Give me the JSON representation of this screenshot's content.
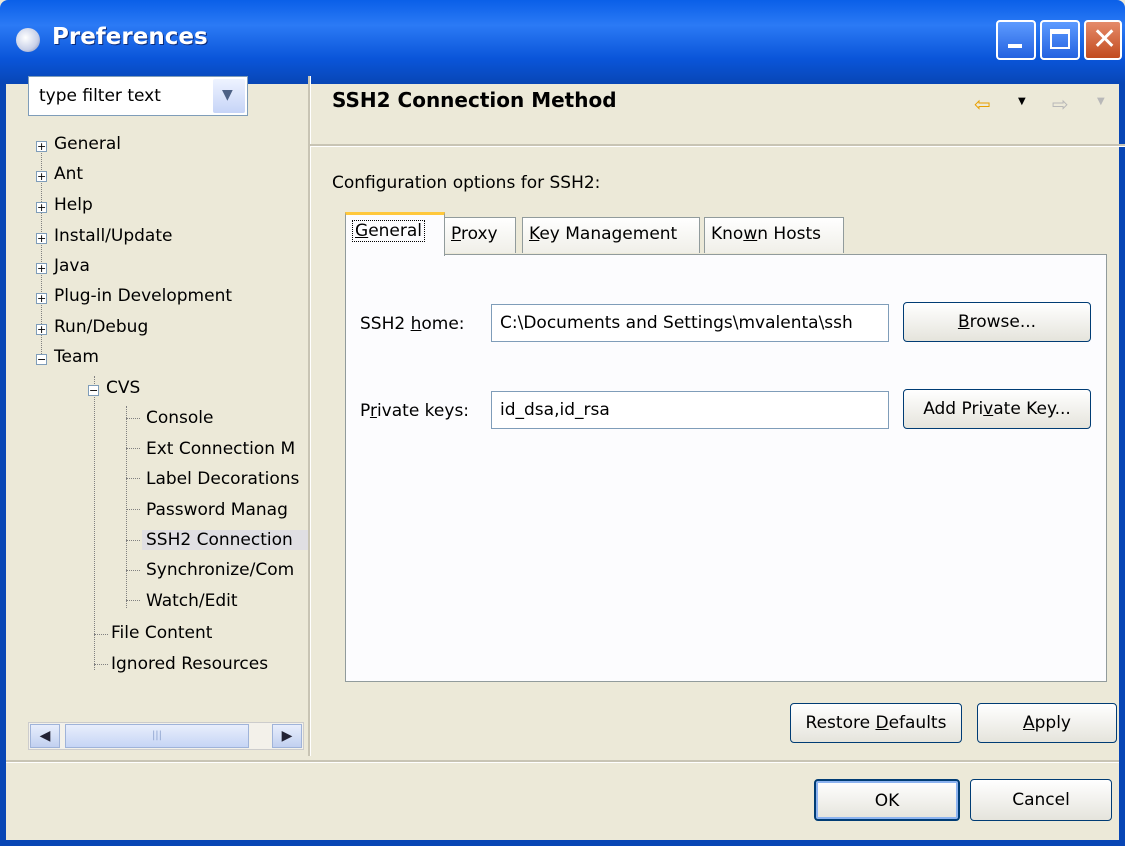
{
  "window": {
    "title": "Preferences"
  },
  "filter": {
    "placeholder": "type filter text"
  },
  "tree": {
    "items": [
      {
        "label": "General",
        "state": "collapsed"
      },
      {
        "label": "Ant",
        "state": "collapsed"
      },
      {
        "label": "Help",
        "state": "collapsed"
      },
      {
        "label": "Install/Update",
        "state": "collapsed"
      },
      {
        "label": "Java",
        "state": "collapsed"
      },
      {
        "label": "Plug-in Development",
        "state": "collapsed"
      },
      {
        "label": "Run/Debug",
        "state": "collapsed"
      },
      {
        "label": "Team",
        "state": "expanded"
      },
      {
        "label": "CVS",
        "state": "expanded"
      },
      {
        "label": "Console"
      },
      {
        "label": "Ext Connection M"
      },
      {
        "label": "Label Decorations"
      },
      {
        "label": "Password Manag"
      },
      {
        "label": "SSH2 Connection",
        "selected": true
      },
      {
        "label": "Synchronize/Com"
      },
      {
        "label": "Watch/Edit"
      },
      {
        "label": "File Content"
      },
      {
        "label": "Ignored Resources"
      }
    ]
  },
  "page": {
    "title": "SSH2 Connection Method",
    "config_label": "Configuration options for SSH2:",
    "tabs": [
      {
        "label": "General",
        "mnemonic": "G",
        "rest": "eneral"
      },
      {
        "label": "Proxy",
        "mnemonic": "P",
        "rest": "roxy"
      },
      {
        "label": "Key Management",
        "mnemonic": "K",
        "rest": "ey Management"
      },
      {
        "label": "Known Hosts",
        "pre": "Kno",
        "mnemonic": "w",
        "rest": "n Hosts"
      }
    ],
    "ssh2_home": {
      "label_pre": "SSH2 ",
      "label_mn": "h",
      "label_rest": "ome:",
      "value": "C:\\Documents and Settings\\mvalenta\\ssh",
      "browse_mn": "B",
      "browse_rest": "rowse..."
    },
    "private_keys": {
      "label_pre": "P",
      "label_mn": "r",
      "label_rest": "ivate keys:",
      "value": "id_dsa,id_rsa",
      "add_pre": "Add Pri",
      "add_mn": "v",
      "add_rest": "ate Key..."
    },
    "restore": {
      "pre": "Restore ",
      "mn": "D",
      "rest": "efaults"
    },
    "apply": {
      "mn": "A",
      "rest": "pply"
    }
  },
  "dialog": {
    "ok": "OK",
    "cancel": "Cancel"
  },
  "icons": {
    "back": "back-arrow-icon",
    "forward": "forward-arrow-icon"
  },
  "colors": {
    "titlebar": "#0a5fe8",
    "dialog_bg": "#ece9d8",
    "active_tab_accent": "#ffc83c",
    "back_arrow": "#e8a000"
  }
}
